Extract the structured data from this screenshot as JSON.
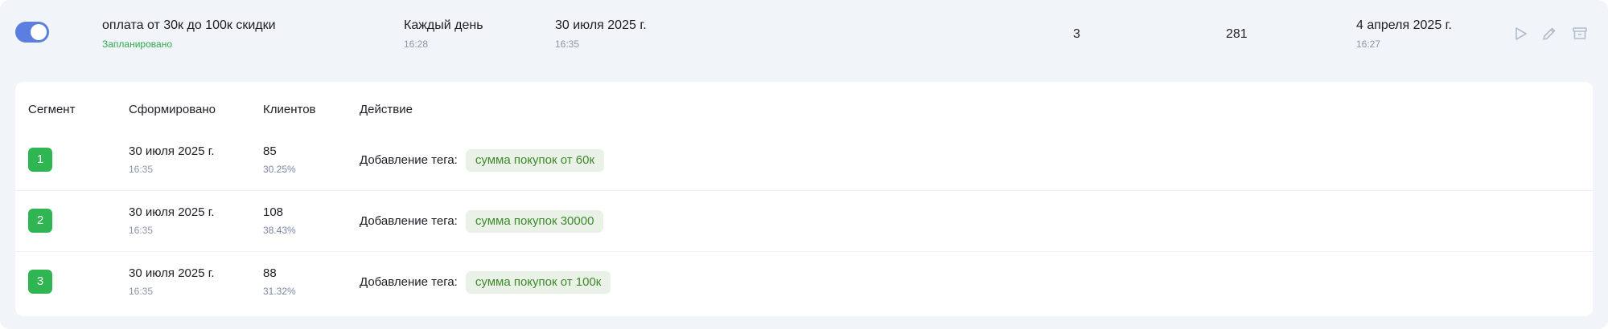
{
  "campaign": {
    "enabled": true,
    "name": "оплата от 30к до 100к скидки",
    "status": "Запланировано",
    "schedule": {
      "label": "Каждый день",
      "time": "16:28"
    },
    "next_run": {
      "date": "30 июля 2025 г.",
      "time": "16:35"
    },
    "segments_count": "3",
    "clients_count": "281",
    "created": {
      "date": "4 апреля 2025 г.",
      "time": "16:27"
    },
    "actions": [
      {
        "name": "run",
        "icon": "play-icon"
      },
      {
        "name": "edit",
        "icon": "pencil-icon"
      },
      {
        "name": "archive",
        "icon": "archive-icon"
      }
    ]
  },
  "segments_table": {
    "headers": {
      "segment": "Сегмент",
      "formed": "Сформировано",
      "clients": "Клиентов",
      "action": "Действие"
    },
    "rows": [
      {
        "segment": "1",
        "date": "30 июля 2025 г.",
        "time": "16:35",
        "clients": "85",
        "percent": "30.25%",
        "action_label": "Добавление тега:",
        "tag": "сумма покупок от 60к"
      },
      {
        "segment": "2",
        "date": "30 июля 2025 г.",
        "time": "16:35",
        "clients": "108",
        "percent": "38.43%",
        "action_label": "Добавление тега:",
        "tag": "сумма покупок 30000"
      },
      {
        "segment": "3",
        "date": "30 июля 2025 г.",
        "time": "16:35",
        "clients": "88",
        "percent": "31.32%",
        "action_label": "Добавление тега:",
        "tag": "сумма покупок от 100к"
      }
    ]
  },
  "colors": {
    "toggle_on": "#5b7fe0",
    "status_green": "#2eab4f",
    "segment_badge": "#2fb552",
    "tag_bg": "#eaf1e6",
    "tag_text": "#3c8a2d",
    "card_bg": "#f1f4f8"
  }
}
